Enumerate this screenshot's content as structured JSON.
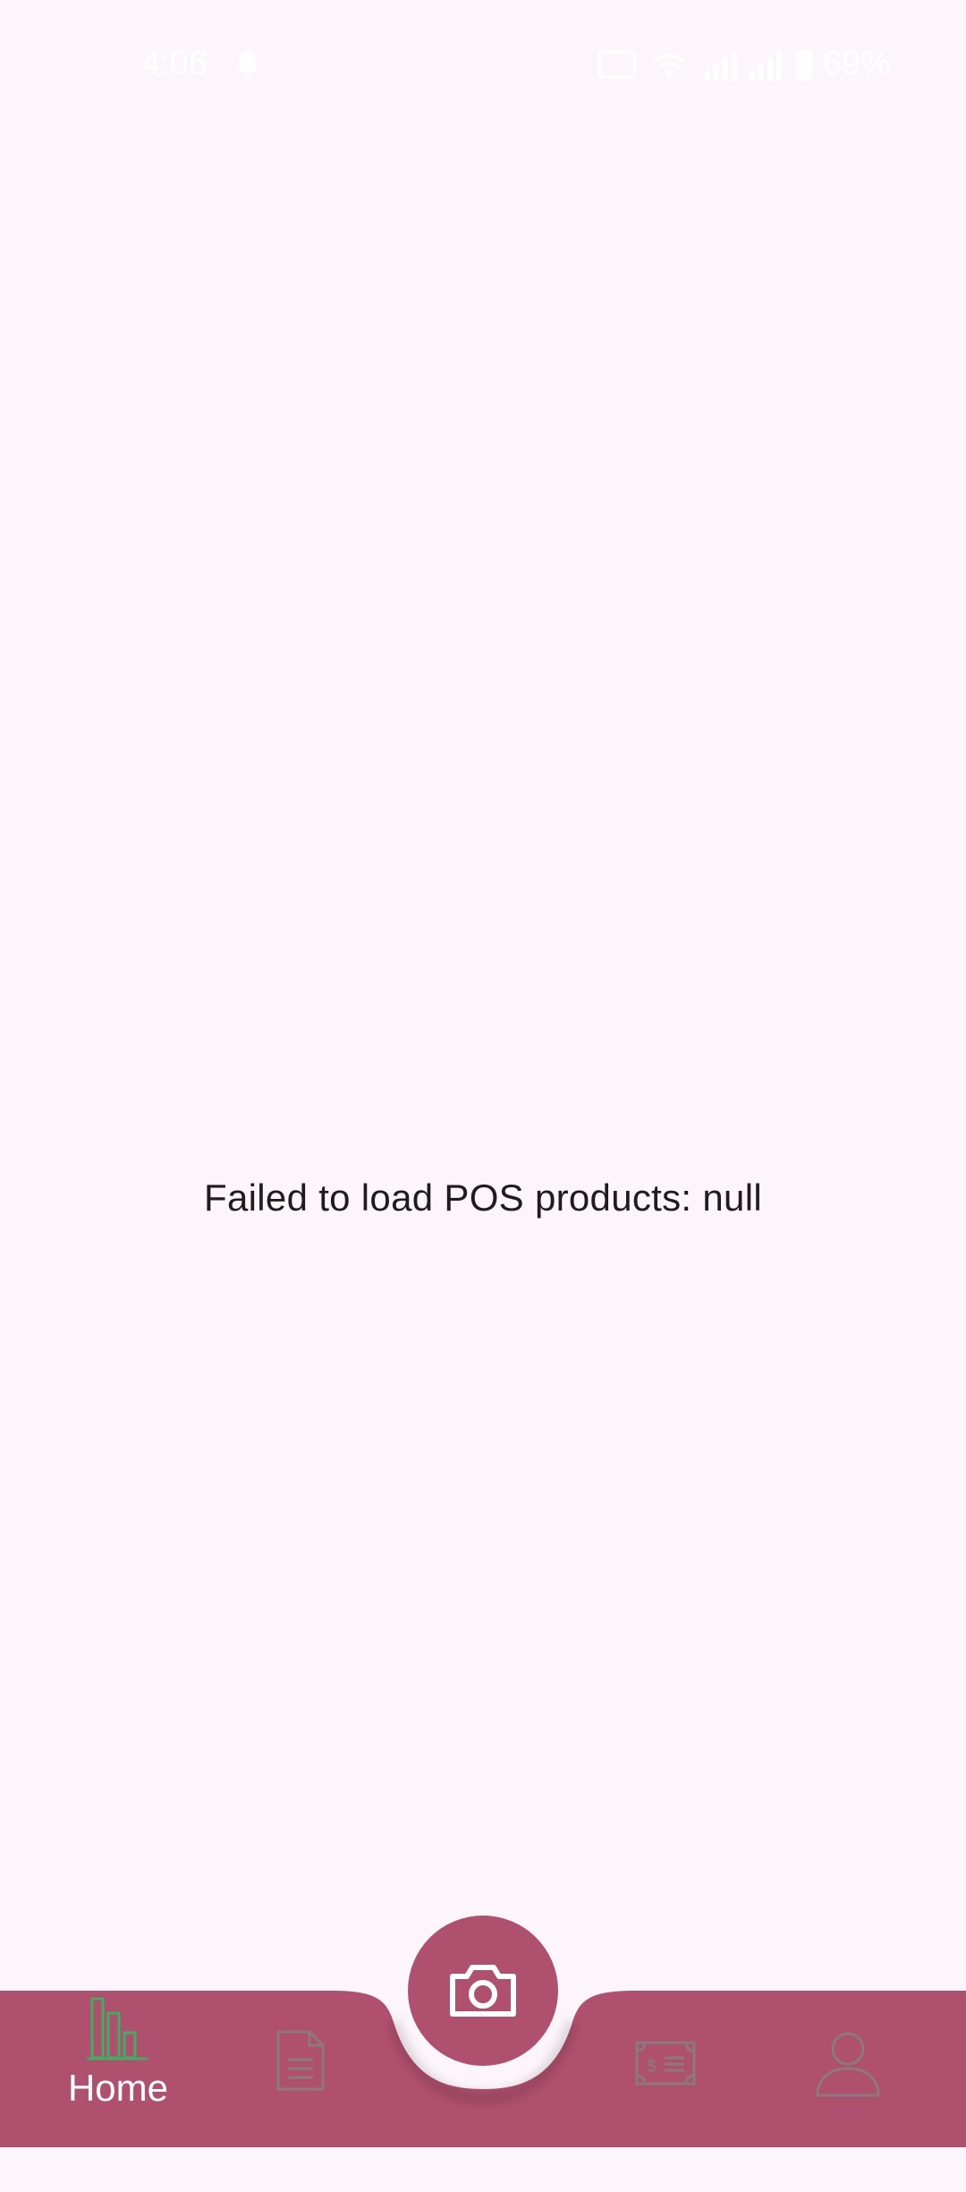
{
  "status_bar": {
    "time": "4:06",
    "battery_percent": "69%"
  },
  "main": {
    "error_message": "Failed to load POS products: null"
  },
  "bottom_nav": {
    "items": [
      {
        "label": "Home",
        "icon": "bar-chart-icon",
        "active": true
      },
      {
        "label": "",
        "icon": "document-icon",
        "active": false
      },
      {
        "label": "",
        "icon": "bill-icon",
        "active": false
      },
      {
        "label": "",
        "icon": "person-icon",
        "active": false
      }
    ],
    "fab_icon": "camera-icon"
  },
  "colors": {
    "background": "#fcf5fc",
    "nav_bar": "#b0506f",
    "active_icon": "#3fae63",
    "inactive_icon": "#8a7a80",
    "text": "#1f1b1f"
  }
}
